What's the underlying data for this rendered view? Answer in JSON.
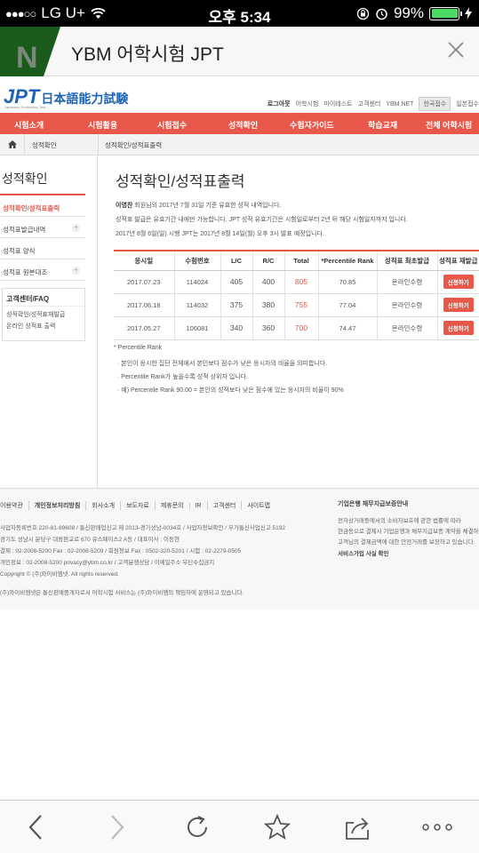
{
  "status": {
    "signal_dots": "●●●○○",
    "carrier": "LG U+",
    "time": "오후 5:34",
    "battery_pct": "99%",
    "battery_level": 0.99
  },
  "app_header": {
    "title": "YBM 어학시험 JPT",
    "logo_letter": "N"
  },
  "site": {
    "logo": "JPT",
    "logo_jp": "日本語能力試験",
    "logo_sub": "Japanese Proficiency Test",
    "util_links": [
      "로그아웃",
      "어학시험",
      "마이테스트",
      "고객센터",
      "YBM.NET"
    ],
    "lang_current": "한국접수",
    "lang_other": "일본접수"
  },
  "nav": [
    "시험소개",
    "시험활용",
    "시험접수",
    "성적확인",
    "수험자가이드",
    "학습교재",
    "전체 어학시험"
  ],
  "breadcrumb": {
    "first": "성적확인",
    "second": "성적확인/성적표출력"
  },
  "sidebar": {
    "title": "성적확인",
    "items": [
      {
        "label": "성적확인/성적표출력",
        "active": true
      },
      {
        "label": "성적표발급내역",
        "active": false
      },
      {
        "label": "성적표 양식",
        "active": false
      },
      {
        "label": "성적표 원본대조",
        "active": false
      }
    ],
    "cs_title": "고객센터/FAQ",
    "cs_links": [
      "성적확인/성적표재발급",
      "온라인 성적표 출력"
    ]
  },
  "main": {
    "title": "성적확인/성적표출력",
    "notice": [
      {
        "name": "이영찬",
        "text": " 회원님의 2017년 7월 31일 기준 유효한 성적 내역입니다."
      },
      {
        "name": "",
        "text": "성적표 발급은 유효기간 내에만 가능합니다. JPT 성적 유효기간은 시험일로부터 2년 뒤 해당 시험일자까지 입니다."
      },
      {
        "name": "",
        "text": "2017년 8월 6일(일) 시행 JPT는 2017년 8월 14일(월) 오후 3시 발표 예정입니다."
      }
    ],
    "table": {
      "headers": [
        "응시일",
        "수험번호",
        "L/C",
        "R/C",
        "Total",
        "*Percentile Rank",
        "성적표 최초발급",
        "성적표 재발급"
      ],
      "rows": [
        {
          "date": "2017.07.23",
          "exam_no": "114024",
          "lc": "405",
          "rc": "400",
          "total": "805",
          "pr": "70.85",
          "first": "온라인수령",
          "reissue": "신청하기"
        },
        {
          "date": "2017.06.18",
          "exam_no": "114032",
          "lc": "375",
          "rc": "380",
          "total": "755",
          "pr": "77.04",
          "first": "온라인수령",
          "reissue": "신청하기"
        },
        {
          "date": "2017.05.27",
          "exam_no": "106081",
          "lc": "340",
          "rc": "360",
          "total": "700",
          "pr": "74.47",
          "first": "온라인수령",
          "reissue": "신청하기"
        }
      ]
    },
    "pr_notes": [
      "* Percentile Rank",
      "· 본인이 응시한 집단 전체에서 본인보다 점수가 낮은 응시자의 비율을 의미합니다.",
      "· Percentile Rank가 높을수록 성적 상위자 입니다.",
      "· 예) Percentile Rank 90.00 = 본인의 성적보다 낮은 점수에 있는 응시자의 비율이 90%"
    ]
  },
  "footer": {
    "links": [
      "이용약관",
      "개인정보처리방침",
      "회사소개",
      "보도자료",
      "제휴문의",
      "IR",
      "고객센터",
      "사이트맵"
    ],
    "info": [
      "사업자등록번호 220-81-89608 / 통신판매업신고 제 2013-경기성남-0034호 / 사업자정보확인 / 부가통신사업신고 5192",
      "경기도 성남시 분당구 대왕판교로 670 유스페이스2 A동 / 대표이사 : 이동현",
      "결제 : 02-2008-5200 Fax : 02-2008-5209 / 회원정보 Fax : 0502-320-5201 / 시험 : 02-2279-0505",
      "개인정보 : 02-2008-5200 privacy@ybm.co.kr / 고객분쟁상담 / 이메일주소 무단수집금지",
      "Copyright © (주)와이비엠넷. All rights reserved.",
      "(주)와이비엠넷은 통신판매중개자로서 어학시험 서비스는 (주)와이비엠의 책임하에 운영되고 있습니다."
    ],
    "right_title": "기업은행 채무지급보증안내",
    "right_lines": [
      "전자상거래등에서의 소비자보호에 관한 법률에 따라",
      "현금등으로 결제시 기업은행과 채무지급보증 계약을 체결하여",
      "고객님의 결제금액에 대한 안전거래를 보장하고 있습니다."
    ],
    "right_link": "서비스가입 사실 확인"
  }
}
